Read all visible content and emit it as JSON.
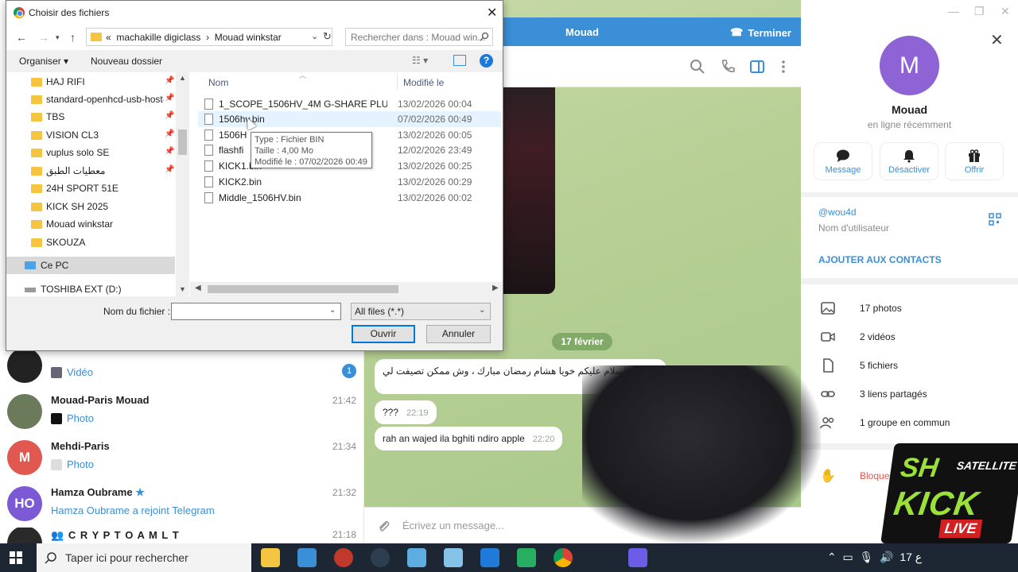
{
  "telegram": {
    "chats": [
      {
        "name": "",
        "sub": "Vidéo",
        "time": "",
        "badge": "1",
        "avatar_color": "#222"
      },
      {
        "name": "Mouad-Paris Mouad",
        "sub": "Photo",
        "time": "21:42",
        "avatar_color": "#6a7a5a"
      },
      {
        "name": "Mehdi-Paris",
        "sub": "Photo",
        "time": "21:34",
        "avatar_letter": "M",
        "avatar_color": "#e0584f"
      },
      {
        "name": "Hamza Oubrame",
        "sub": "Hamza Oubrame a rejoint Telegram",
        "time": "21:32",
        "avatar_letter": "HO",
        "avatar_color": "#7c5ad6"
      },
      {
        "name": "C R Y P T O A M L T",
        "sub": "",
        "time": "21:18",
        "avatar_color": "#2a2a2a"
      }
    ],
    "call_bar": {
      "name": "Mouad",
      "end": "Terminer"
    },
    "date_pill": "17 février",
    "messages": [
      {
        "text": "السلام عليكم خويا هشام رمضان مبارك ، وش ممكن تصيفت لي loader",
        "time": "16:1"
      },
      {
        "text": "???",
        "time": "22:19"
      },
      {
        "text": "rah an wajed ila bghiti ndiro apple",
        "time": "22:20"
      }
    ],
    "compose_placeholder": "Écrivez un message...",
    "profile": {
      "avatar_letter": "M",
      "name": "Mouad",
      "status": "en ligne récemment",
      "actions": [
        "Message",
        "Désactiver",
        "Offrir"
      ],
      "username": "@wou4d",
      "username_label": "Nom d'utilisateur",
      "add_contact": "AJOUTER AUX CONTACTS",
      "media": [
        "17 photos",
        "2 vidéos",
        "5 fichiers",
        "3 liens partagés",
        "1 groupe en commun"
      ],
      "block": "Bloquer l'ut"
    }
  },
  "overlay_logo": {
    "sh": "SH",
    "satellite": "SATELLITE",
    "kick": "KICK",
    "live": "LIVE"
  },
  "dialog": {
    "title": "Choisir des fichiers",
    "path": [
      "«",
      "machakille digiclass",
      "›",
      "Mouad winkstar"
    ],
    "search_placeholder": "Rechercher dans : Mouad win...",
    "toolbar": {
      "organize": "Organiser ▾",
      "new_folder": "Nouveau dossier"
    },
    "tree": [
      {
        "label": "HAJ RIFI",
        "pinned": true
      },
      {
        "label": "standard-openhcd-usb-host-",
        "pinned": true
      },
      {
        "label": "TBS",
        "pinned": true
      },
      {
        "label": "VISION CL3",
        "pinned": true
      },
      {
        "label": "vuplus solo SE",
        "pinned": true
      },
      {
        "label": "معطيات الطبق",
        "pinned": true
      },
      {
        "label": "24H SPORT 51E",
        "pinned": false
      },
      {
        "label": "KICK SH 2025",
        "pinned": false
      },
      {
        "label": "Mouad winkstar",
        "pinned": false
      },
      {
        "label": "SKOUZA",
        "pinned": false
      }
    ],
    "this_pc": "Ce PC",
    "drive": "TOSHIBA EXT (D:)",
    "columns": {
      "name": "Nom",
      "modified": "Modifié le"
    },
    "files": [
      {
        "name": "1_SCOPE_1506HV_4M G-SHARE PLUS V 5...",
        "date": "13/02/2026 00:04"
      },
      {
        "name": "1506hv.bin",
        "date": "07/02/2026 00:49"
      },
      {
        "name": "1506H",
        "date": "13/02/2026 00:05"
      },
      {
        "name": "flashfi",
        "date": "12/02/2026 23:49"
      },
      {
        "name": "KICK1.bin",
        "date": "13/02/2026 00:25"
      },
      {
        "name": "KICK2.bin",
        "date": "13/02/2026 00:29"
      },
      {
        "name": "Middle_1506HV.bin",
        "date": "13/02/2026 00:02"
      }
    ],
    "tooltip": [
      "Type : Fichier BIN",
      "Taille : 4,00 Mo",
      "Modifié le : 07/02/2026 00:49"
    ],
    "footer": {
      "filename_label": "Nom du fichier :",
      "filename_value": "",
      "filetype": "All files (*.*)",
      "open": "Ouvrir",
      "cancel": "Annuler"
    }
  },
  "taskbar": {
    "search_placeholder": "Taper ici pour rechercher",
    "tray": "ع 17"
  }
}
